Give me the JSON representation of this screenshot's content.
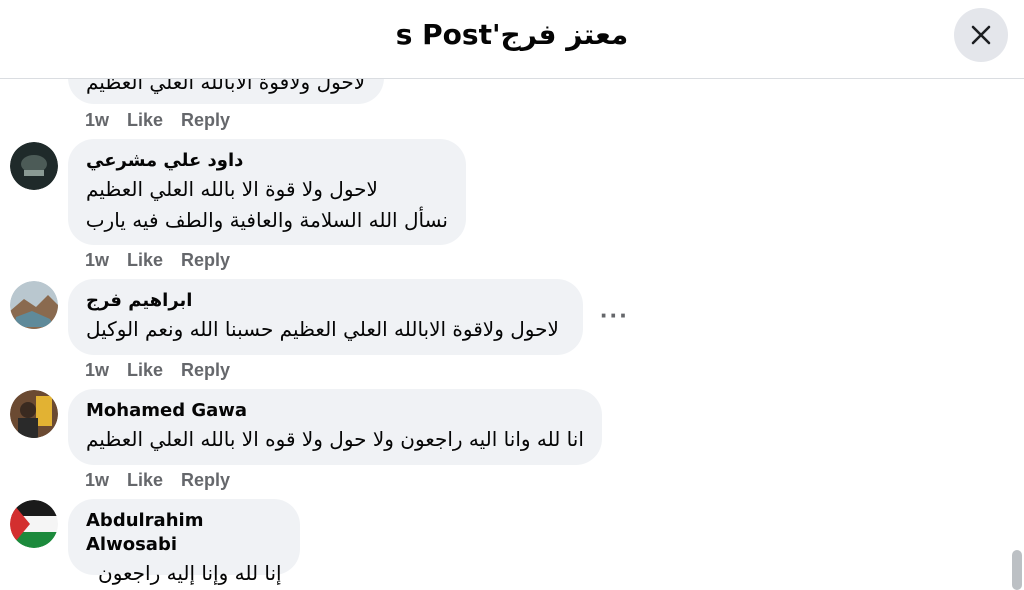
{
  "header": {
    "title": "معتز فرج's Post"
  },
  "comments": [
    {
      "author": "",
      "lines": [
        "لاحول ولاقوة الابالله العلي العظيم"
      ],
      "time": "1w",
      "like": "Like",
      "reply": "Reply"
    },
    {
      "author": "داود علي مشرعي",
      "lines": [
        "لاحول ولا قوة الا بالله العلي العظيم",
        "نسأل الله السلامة والعافية والطف فيه يارب"
      ],
      "time": "1w",
      "like": "Like",
      "reply": "Reply"
    },
    {
      "author": "ابراهيم فرج",
      "lines": [
        "لاحول ولاقوة الابالله العلي العظيم حسبنا الله ونعم الوكيل"
      ],
      "time": "1w",
      "like": "Like",
      "reply": "Reply",
      "more": "···"
    },
    {
      "author": "Mohamed Gawa",
      "lines": [
        "انا لله وانا اليه راجعون ولا حول ولا قوه الا بالله العلي العظيم"
      ],
      "time": "1w",
      "like": "Like",
      "reply": "Reply"
    },
    {
      "author": "Abdulrahim Alwosabi",
      "lines": [
        "إنا لله وإنا إليه راجعون"
      ]
    }
  ],
  "icons": {
    "close": "close-icon",
    "more": "more-options-icon"
  }
}
